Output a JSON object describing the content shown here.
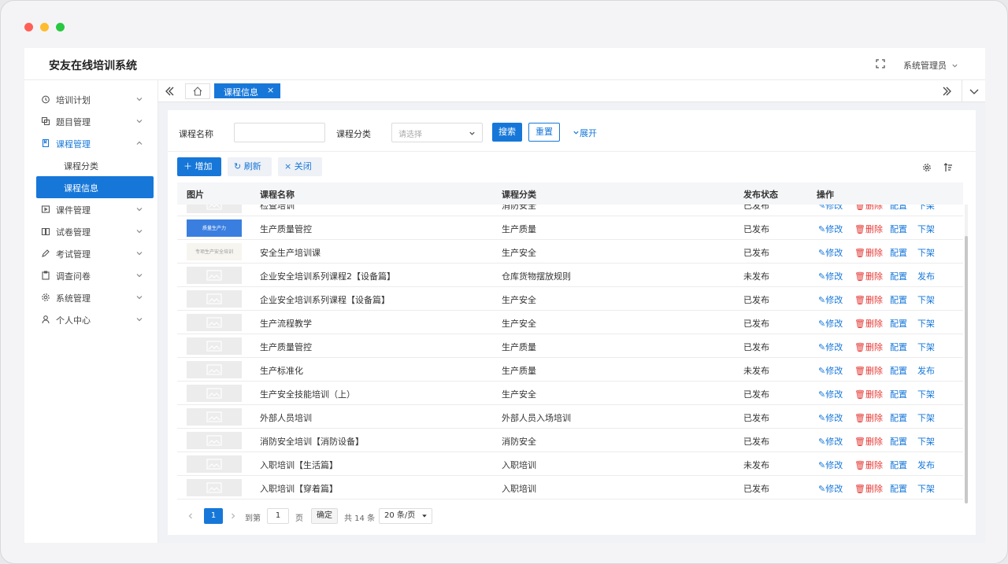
{
  "window": {
    "dot_colors": [
      "#ff5f57",
      "#febc2e",
      "#28c840"
    ]
  },
  "header": {
    "title": "安友在线培训系统",
    "user": "系统管理员"
  },
  "sidebar": {
    "items": [
      {
        "label": "培训计划",
        "icon": "alarm-clock-icon"
      },
      {
        "label": "题目管理",
        "icon": "copy-icon"
      },
      {
        "label": "课程管理",
        "icon": "book-icon",
        "open": true
      },
      {
        "label": "课件管理",
        "icon": "play-icon"
      },
      {
        "label": "试卷管理",
        "icon": "book-open-icon"
      },
      {
        "label": "考试管理",
        "icon": "pen-icon"
      },
      {
        "label": "调查问卷",
        "icon": "clipboard-icon"
      },
      {
        "label": "系统管理",
        "icon": "gear-icon"
      },
      {
        "label": "个人中心",
        "icon": "user-icon"
      }
    ],
    "sub_items": [
      {
        "label": "课程分类",
        "active": false
      },
      {
        "label": "课程信息",
        "active": true
      }
    ]
  },
  "tabs": {
    "active_label": "课程信息",
    "close": "×"
  },
  "search": {
    "name_label": "课程名称",
    "name_value": "",
    "category_label": "课程分类",
    "category_placeholder": "请选择",
    "search_btn": "搜索",
    "reset_btn": "重置",
    "expand": "展开"
  },
  "toolbar": {
    "add": "增加",
    "refresh": "刷新",
    "close": "关闭"
  },
  "table": {
    "columns": [
      "图片",
      "课程名称",
      "课程分类",
      "发布状态",
      "操作"
    ],
    "actions": {
      "edit": "修改",
      "delete": "删除",
      "config": "配置"
    },
    "rows": [
      {
        "name": "检查培训",
        "category": "消防安全",
        "status": "已发布",
        "toggle": "下架",
        "thumb": "placeholder"
      },
      {
        "name": "生产质量管控",
        "category": "生产质量",
        "status": "已发布",
        "toggle": "下架",
        "thumb": "blue",
        "thumb_text": "质量生产力"
      },
      {
        "name": "安全生产培训课",
        "category": "生产安全",
        "status": "已发布",
        "toggle": "下架",
        "thumb": "light",
        "thumb_text": "专项生产安全培训"
      },
      {
        "name": "企业安全培训系列课程2【设备篇】",
        "category": "仓库货物摆放规则",
        "status": "未发布",
        "toggle": "发布",
        "thumb": "placeholder"
      },
      {
        "name": "企业安全培训系列课程【设备篇】",
        "category": "生产安全",
        "status": "已发布",
        "toggle": "下架",
        "thumb": "placeholder"
      },
      {
        "name": "生产流程教学",
        "category": "生产安全",
        "status": "已发布",
        "toggle": "下架",
        "thumb": "placeholder"
      },
      {
        "name": "生产质量管控",
        "category": "生产质量",
        "status": "已发布",
        "toggle": "下架",
        "thumb": "placeholder"
      },
      {
        "name": "生产标准化",
        "category": "生产质量",
        "status": "未发布",
        "toggle": "发布",
        "thumb": "placeholder"
      },
      {
        "name": "生产安全技能培训（上）",
        "category": "生产安全",
        "status": "已发布",
        "toggle": "下架",
        "thumb": "placeholder"
      },
      {
        "name": "外部人员培训",
        "category": "外部人员入场培训",
        "status": "已发布",
        "toggle": "下架",
        "thumb": "placeholder"
      },
      {
        "name": "消防安全培训【消防设备】",
        "category": "消防安全",
        "status": "已发布",
        "toggle": "下架",
        "thumb": "placeholder"
      },
      {
        "name": "入职培训【生活篇】",
        "category": "入职培训",
        "status": "未发布",
        "toggle": "发布",
        "thumb": "placeholder"
      },
      {
        "name": "入职培训【穿着篇】",
        "category": "入职培训",
        "status": "已发布",
        "toggle": "下架",
        "thumb": "placeholder"
      }
    ]
  },
  "pager": {
    "current": "1",
    "goto_label": "到第",
    "goto_value": "1",
    "page_unit": "页",
    "confirm": "确定",
    "total": "共 14 条",
    "page_size": "20 条/页"
  },
  "colors": {
    "primary": "#1677d9",
    "danger": "#e53935"
  }
}
